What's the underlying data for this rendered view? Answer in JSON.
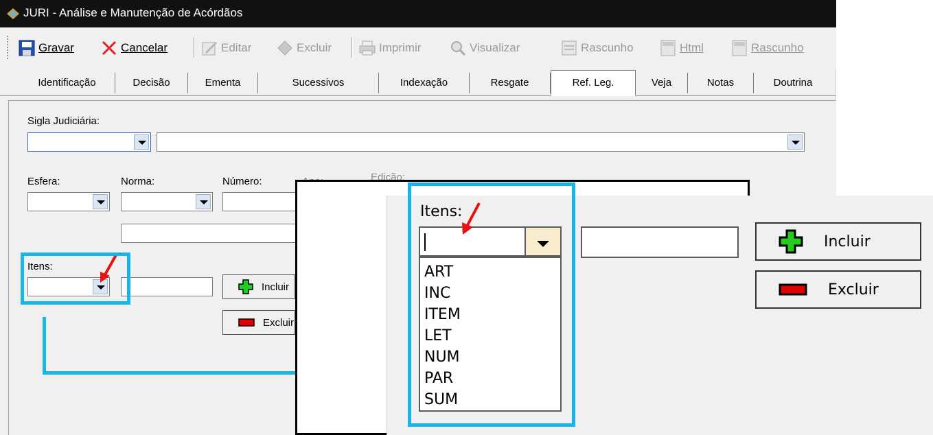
{
  "window": {
    "title": "JURI - Análise e Manutenção de Acórdãos"
  },
  "toolbar": {
    "buttons": [
      {
        "label": "Gravar",
        "icon": "save-icon",
        "enabled": true
      },
      {
        "label": "Cancelar",
        "icon": "cancel-x-icon",
        "enabled": true
      },
      {
        "label": "Editar",
        "icon": "edit-icon",
        "enabled": false
      },
      {
        "label": "Excluir",
        "icon": "delete-icon",
        "enabled": false
      },
      {
        "label": "Imprimir",
        "icon": "printer-icon",
        "enabled": false
      },
      {
        "label": "Visualizar",
        "icon": "preview-icon",
        "enabled": false
      },
      {
        "label": "Rascunho",
        "icon": "tmp-draft-icon",
        "enabled": false
      },
      {
        "label": "Html",
        "icon": "html-icon",
        "enabled": false
      },
      {
        "label": "Rascunho",
        "icon": "tmp-draft-html-icon",
        "enabled": false
      }
    ]
  },
  "tabs": [
    {
      "label": "Identificação",
      "active": false
    },
    {
      "label": "Decisão",
      "active": false
    },
    {
      "label": "Ementa",
      "active": false
    },
    {
      "label": "Sucessivos",
      "active": false
    },
    {
      "label": "Indexação",
      "active": false
    },
    {
      "label": "Resgate",
      "active": false
    },
    {
      "label": "Ref. Leg.",
      "active": true
    },
    {
      "label": "Veja",
      "active": false
    },
    {
      "label": "Notas",
      "active": false
    },
    {
      "label": "Doutrina",
      "active": false
    }
  ],
  "form": {
    "sigla_label": "Sigla Judiciária:",
    "esfera_label": "Esfera:",
    "norma_label": "Norma:",
    "numero_label": "Número:",
    "ano_label": "Ano:",
    "edicao_label": "Edição:",
    "itens_label": "Itens:",
    "incluir_label": "Incluir",
    "excluir_label": "Excluir"
  },
  "zoom": {
    "itens_label": "Itens:",
    "itens_options": [
      "ART",
      "INC",
      "ITEM",
      "LET",
      "NUM",
      "PAR",
      "SUM"
    ],
    "incluir_label": "Incluir",
    "excluir_label": "Excluir"
  },
  "colors": {
    "highlight": "#19b4e8",
    "arrow": "#e81010",
    "add_icon": "#22cc22",
    "remove_icon": "#e00000"
  }
}
